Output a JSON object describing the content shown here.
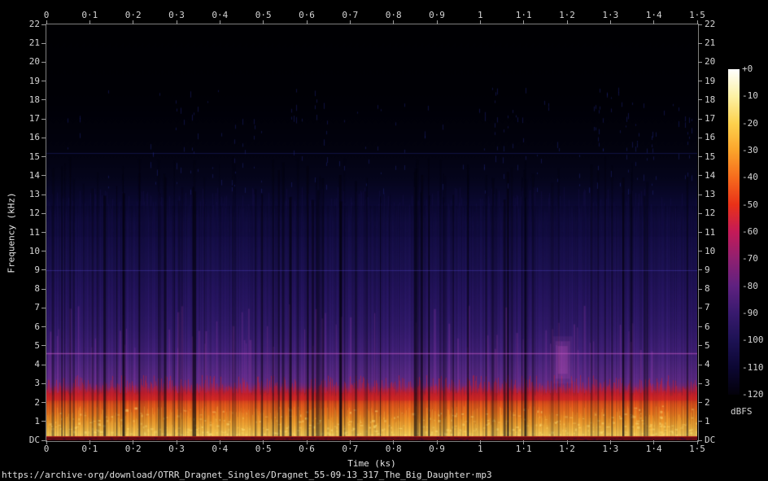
{
  "footer": {
    "url": "https://archive·org/download/OTRR_Dragnet_Singles/Dragnet_55-09-13_317_The_Big_Daughter·mp3"
  },
  "chart_data": {
    "type": "heatmap",
    "subtype": "audio-spectrogram",
    "xlabel": "Time (ks)",
    "ylabel": "Frequency (kHz)",
    "x_range": [
      0,
      1.5
    ],
    "y_range": [
      0,
      22
    ],
    "z_label": "dBFS",
    "z_range": [
      0,
      -120
    ],
    "grid": false,
    "legend_position": "right-colorbar",
    "x_tick_labels": [
      "0",
      "0·1",
      "0·2",
      "0·3",
      "0·4",
      "0·5",
      "0·6",
      "0·7",
      "0·8",
      "0·9",
      "1",
      "1·1",
      "1·2",
      "1·3",
      "1·4",
      "1·5"
    ],
    "y_tick_labels": [
      "22",
      "21",
      "20",
      "19",
      "18",
      "17",
      "16",
      "15",
      "14",
      "13",
      "12",
      "11",
      "10",
      "9",
      "8",
      "7",
      "6",
      "5",
      "4",
      "3",
      "2",
      "1",
      "DC"
    ],
    "colorbar_tick_labels": [
      "+0",
      "-10",
      "-20",
      "-30",
      "-40",
      "-50",
      "-60",
      "-70",
      "-80",
      "-90",
      "-100",
      "-110",
      "-120"
    ],
    "colorbar_stops": [
      "#ffffff",
      "#fcf1a4",
      "#fdd14d",
      "#fba42b",
      "#f66b1d",
      "#e93118",
      "#c41a58",
      "#8f2070",
      "#5f2180",
      "#381a6e",
      "#1d1254",
      "#0c0733",
      "#03010a"
    ],
    "freq_profile": [
      {
        "khz": 22,
        "color": "#000003"
      },
      {
        "khz": 18,
        "color": "#000006"
      },
      {
        "khz": 15.5,
        "color": "#02020e"
      },
      {
        "khz": 13.8,
        "color": "#05051c"
      },
      {
        "khz": 12.6,
        "color": "#0a0830"
      },
      {
        "khz": 11.5,
        "color": "#120d42"
      },
      {
        "khz": 10.5,
        "color": "#170f4c"
      },
      {
        "khz": 9.5,
        "color": "#1c1254"
      },
      {
        "khz": 9,
        "color": "#1f1358"
      },
      {
        "khz": 8,
        "color": "#261562"
      },
      {
        "khz": 7,
        "color": "#2d186a"
      },
      {
        "khz": 6,
        "color": "#351c72"
      },
      {
        "khz": 5,
        "color": "#43217e"
      },
      {
        "khz": 4.5,
        "color": "#4a2483"
      },
      {
        "khz": 4,
        "color": "#542988"
      },
      {
        "khz": 3.5,
        "color": "#5f2c8e"
      },
      {
        "khz": 3.1,
        "color": "#682f91"
      },
      {
        "khz": 2.9,
        "color": "#7c2d84"
      },
      {
        "khz": 2.7,
        "color": "#a02866"
      },
      {
        "khz": 2.5,
        "color": "#c42436"
      },
      {
        "khz": 2.2,
        "color": "#e03a20"
      },
      {
        "khz": 1.9,
        "color": "#ef5a1d"
      },
      {
        "khz": 1.5,
        "color": "#f4761f"
      },
      {
        "khz": 1.1,
        "color": "#f79426"
      },
      {
        "khz": 0.7,
        "color": "#fbb23a"
      },
      {
        "khz": 0.35,
        "color": "#fdcf55"
      },
      {
        "khz": 0.12,
        "color": "#fede6e"
      },
      {
        "khz": 0,
        "color": "#fee27a"
      }
    ],
    "horizontal_lines": [
      {
        "khz": 4.6,
        "color": "rgba(212,100,212,0.48)",
        "glow": true
      },
      {
        "khz": 9.0,
        "color": "rgba(85,72,205,0.38)",
        "glow": false
      },
      {
        "khz": 15.2,
        "color": "rgba(32,36,115,0.5)",
        "glow": false
      }
    ],
    "notable_features": [
      {
        "time_ks": 1.19,
        "freq_khz": [
          3.0,
          5.5
        ],
        "desc": "bright magenta energy burst"
      }
    ],
    "dc_band_color": "#650a12",
    "texture": {
      "dark_gap_streaks": 95,
      "bright_magenta_streaks": 70,
      "bright_bottom_blobs": 700,
      "hf_streak_khz": [
        13.2,
        18.7
      ]
    }
  }
}
